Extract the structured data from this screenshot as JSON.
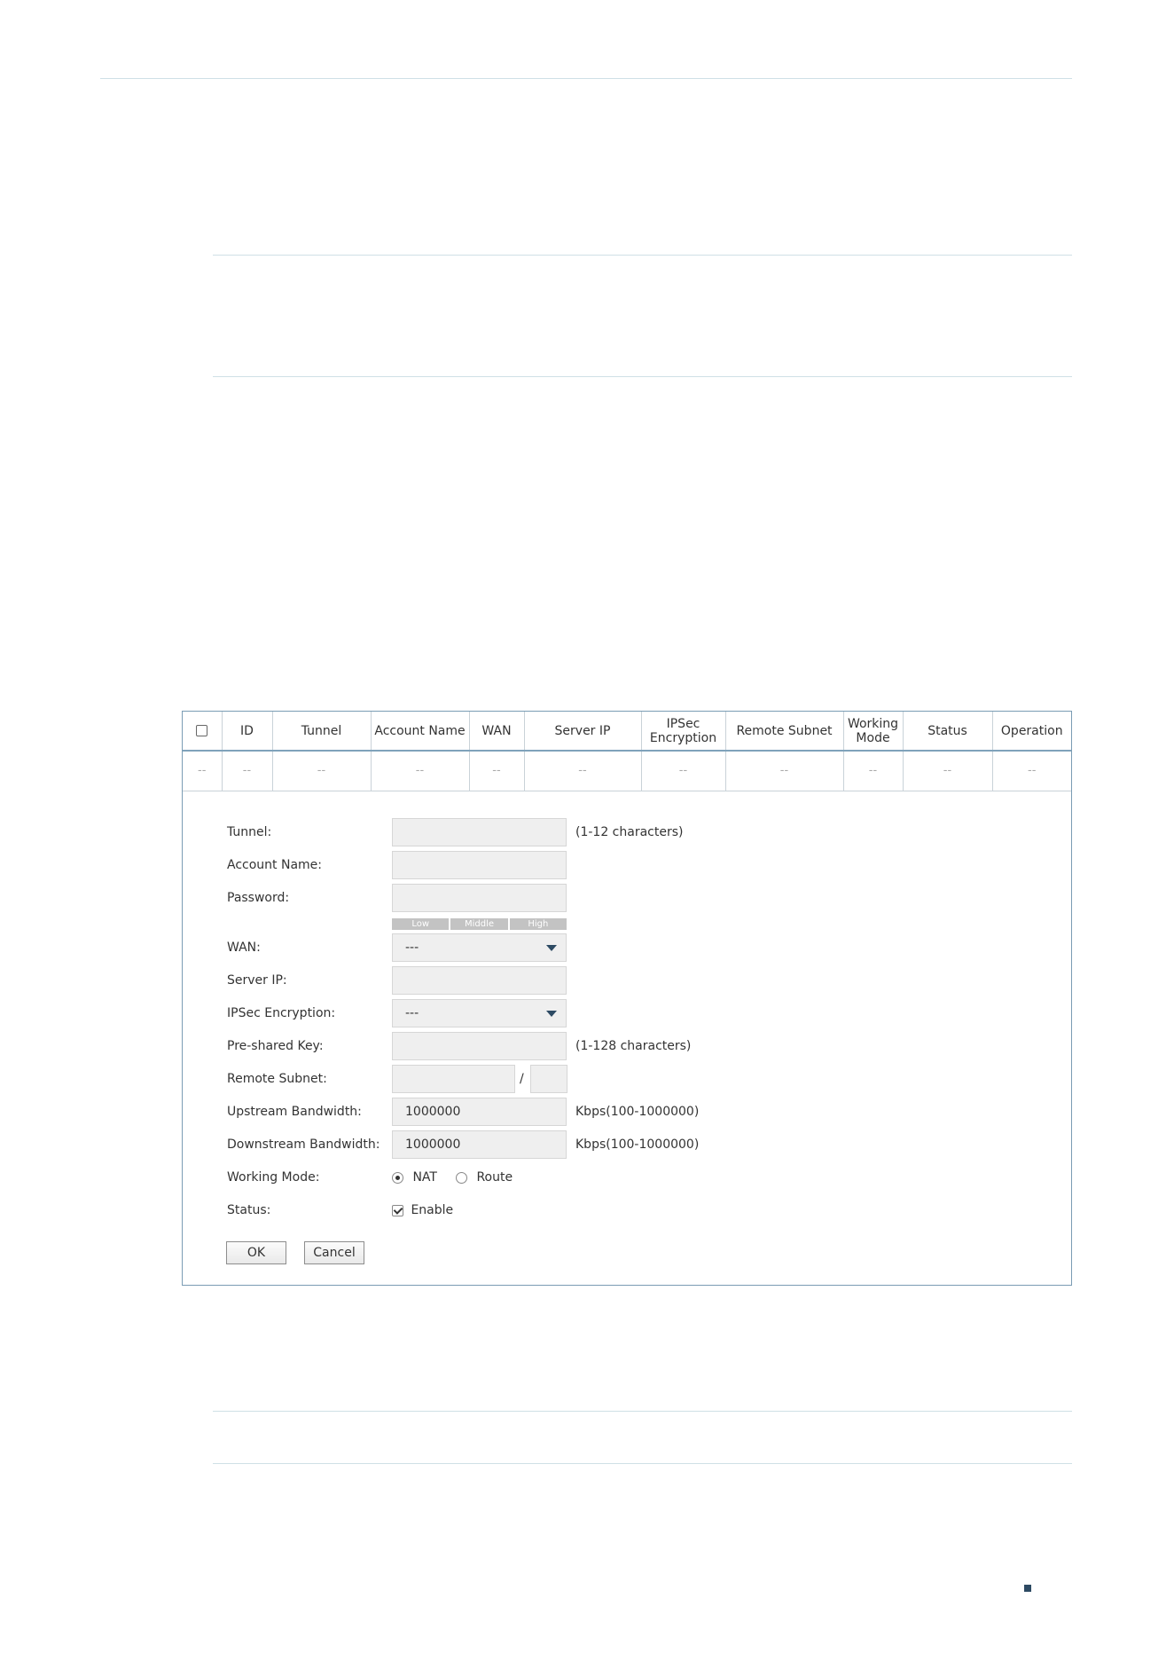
{
  "table": {
    "columns": [
      "",
      "ID",
      "Tunnel",
      "Account Name",
      "WAN",
      "Server IP",
      "IPSec Encryption",
      "Remote Subnet",
      "Working Mode",
      "Status",
      "Operation"
    ],
    "empty_row": [
      "--",
      "--",
      "--",
      "--",
      "--",
      "--",
      "--",
      "--",
      "--",
      "--",
      "--"
    ]
  },
  "form": {
    "tunnel": {
      "label": "Tunnel:",
      "value": "",
      "hint": "(1-12 characters)"
    },
    "account_name": {
      "label": "Account Name:",
      "value": ""
    },
    "password": {
      "label": "Password:",
      "value": "",
      "strength": [
        "Low",
        "Middle",
        "High"
      ]
    },
    "wan": {
      "label": "WAN:",
      "selected": "---"
    },
    "server_ip": {
      "label": "Server IP:",
      "value": ""
    },
    "ipsec_encryption": {
      "label": "IPSec Encryption:",
      "selected": "---"
    },
    "pre_shared_key": {
      "label": "Pre-shared Key:",
      "value": "",
      "hint": "(1-128 characters)"
    },
    "remote_subnet": {
      "label": "Remote Subnet:",
      "ip": "",
      "separator": "/",
      "mask": ""
    },
    "upstream_bandwidth": {
      "label": "Upstream Bandwidth:",
      "value": "1000000",
      "hint": "Kbps(100-1000000)"
    },
    "downstream_bandwidth": {
      "label": "Downstream Bandwidth:",
      "value": "1000000",
      "hint": "Kbps(100-1000000)"
    },
    "working_mode": {
      "label": "Working Mode:",
      "options": [
        "NAT",
        "Route"
      ],
      "selected": "NAT"
    },
    "status": {
      "label": "Status:",
      "checkbox_label": "Enable",
      "checked": true
    },
    "buttons": {
      "ok": "OK",
      "cancel": "Cancel"
    }
  },
  "colors": {
    "accent": "#2d4a63",
    "panel_border": "#7a9cb4",
    "rule": "#cfe0e6"
  }
}
